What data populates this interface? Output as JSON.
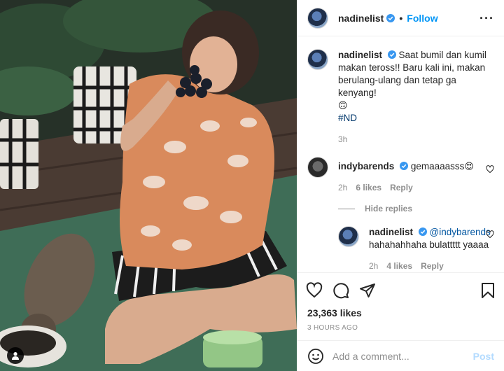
{
  "post": {
    "author": "nadinelist",
    "follow_label": "Follow",
    "separator": "•",
    "caption": {
      "username": "nadinelist",
      "text": "Saat bumil dan kumil makan teross!! Baru kali ini, makan berulang-ulang dan tetap ga kenyang!",
      "emoji": "🙃",
      "hashtag": "#ND",
      "time": "3h"
    },
    "comments": [
      {
        "username": "indybarends",
        "text": "gemaaaasss",
        "emoji": "😍",
        "time": "2h",
        "likes": "6 likes",
        "reply_label": "Reply",
        "hide_replies": "Hide replies",
        "replies": [
          {
            "username": "nadinelist",
            "mention": "@indybarends",
            "text": "hahahahhaha bulattttt yaaaa",
            "time": "2h",
            "likes": "4 likes",
            "reply_label": "Reply"
          }
        ]
      }
    ],
    "like_count": "23,363 likes",
    "posted_ago": "3 HOURS AGO",
    "add_comment_placeholder": "Add a comment...",
    "post_button": "Post"
  },
  "colors": {
    "accent": "#0095f6",
    "verified": "#3897f0",
    "muted": "#8e8e8e",
    "post_disabled": "#b3dbff"
  },
  "icons": {
    "options": "more-options-icon",
    "like": "heart-icon",
    "comment": "comment-icon",
    "share": "share-icon",
    "save": "bookmark-icon",
    "emoji": "emoji-icon",
    "tag": "user-tag-icon"
  }
}
